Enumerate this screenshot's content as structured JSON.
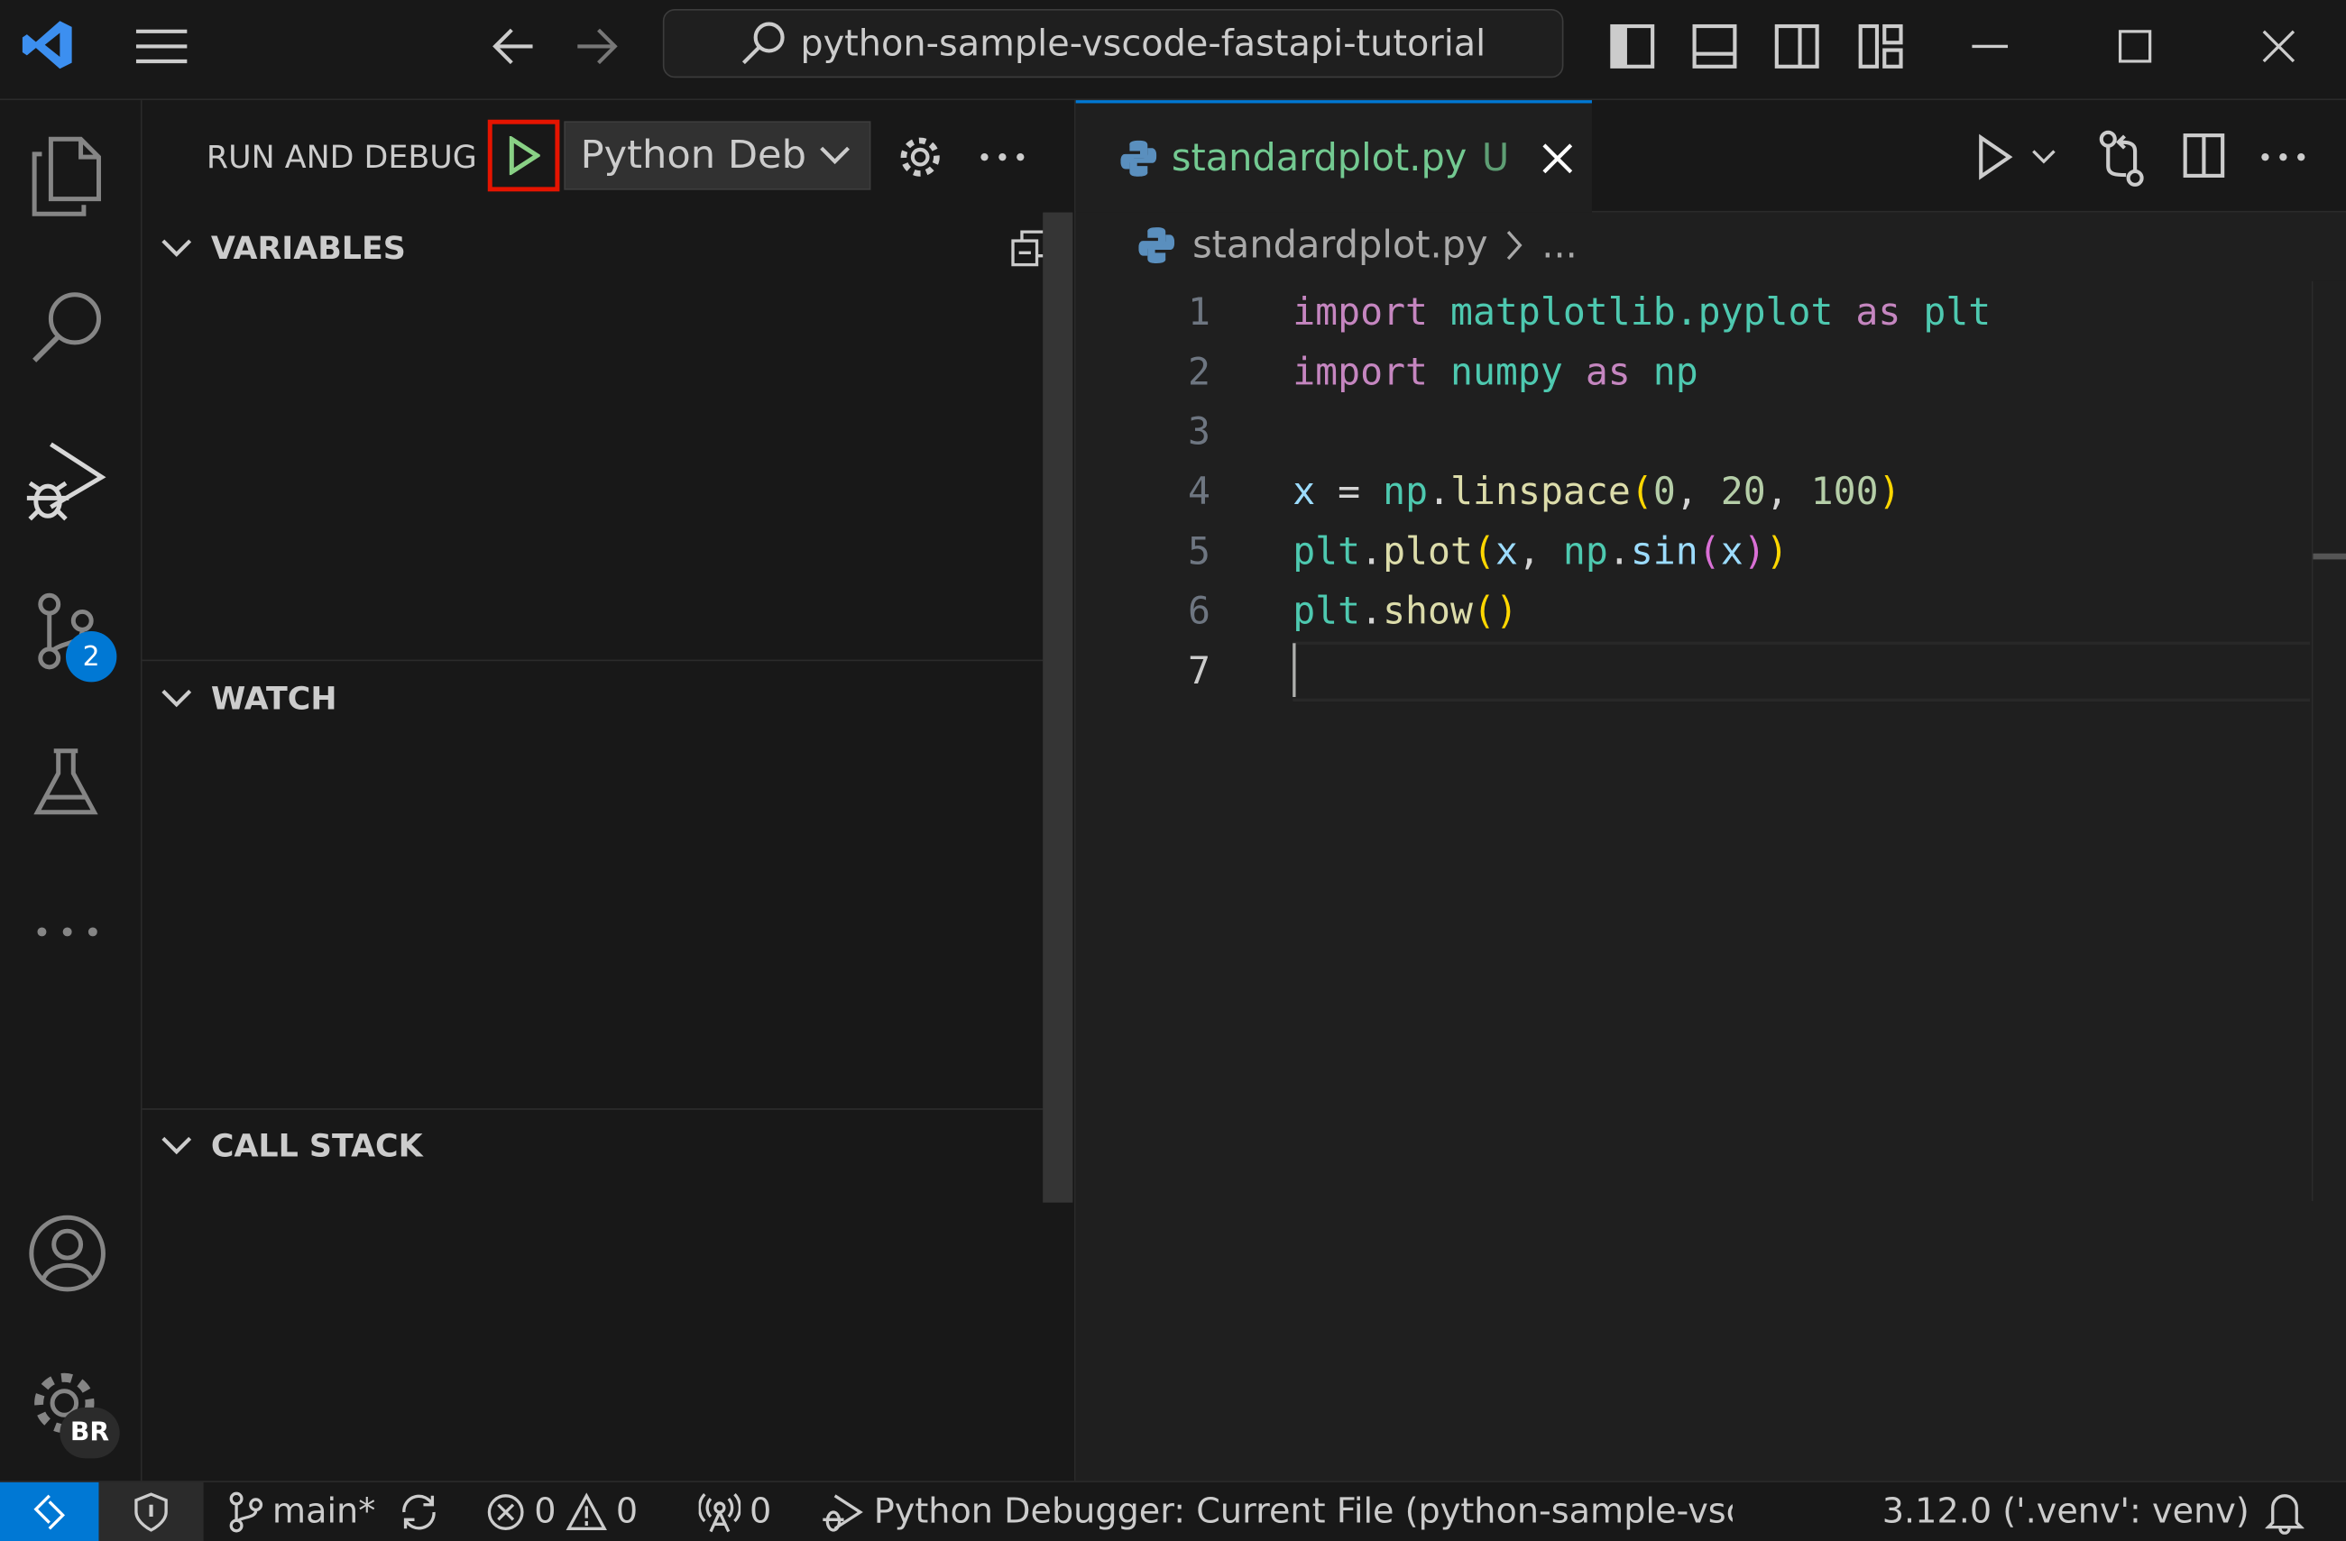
{
  "titlebar": {
    "search_text": "python-sample-vscode-fastapi-tutorial"
  },
  "sidebar": {
    "title": "RUN AND DEBUG",
    "config": "Python Deb",
    "sections": [
      "VARIABLES",
      "WATCH",
      "CALL STACK"
    ]
  },
  "activity": {
    "scm_badge": "2",
    "account_badge": "BR"
  },
  "editor": {
    "tab_name": "standardplot.py",
    "tab_status": "U",
    "breadcrumb_file": "standardplot.py",
    "breadcrumb_more": "...",
    "line_numbers": [
      "1",
      "2",
      "3",
      "4",
      "5",
      "6",
      "7"
    ]
  },
  "status": {
    "branch": "main*",
    "errors": "0",
    "warnings": "0",
    "ports": "0",
    "debug": "Python Debugger: Current File (python-sample-vscc",
    "interpreter": "3.12.0 ('.venv': venv)"
  },
  "colors": {
    "accent": "#0078d4",
    "highlight_box": "#e51400",
    "run_green": "#89d185"
  }
}
